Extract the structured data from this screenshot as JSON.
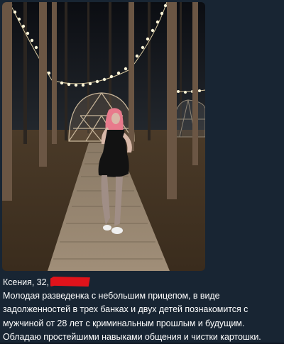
{
  "post": {
    "caption_lines": [
      "Ксения, 32,",
      "Молодая разведенка с небольшим прицепом, в виде",
      "задолженностей в трех банках и двух детей познакомится с",
      "мужчиной от 28 лет с криминальным прошлым и будущим.",
      "Обладаю простейшими навыками общения и чистки картошки."
    ]
  },
  "colors": {
    "background": "#182533",
    "text": "#ffffff",
    "redaction": "#e0131b"
  },
  "icons": {
    "redaction": "red-scribble"
  }
}
